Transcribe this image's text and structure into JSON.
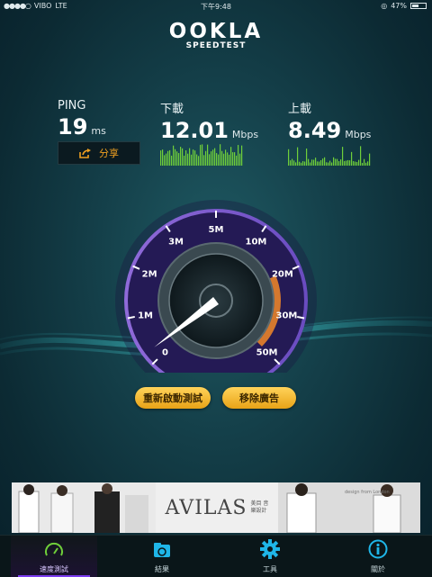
{
  "status_bar": {
    "signal": "●●●●○",
    "carrier": "VIBO",
    "network": "LTE",
    "time": "下午9:48",
    "battery_percent": 47,
    "battery_label": "47%"
  },
  "logo": {
    "main": "OOKLA",
    "sub": "SPEEDTEST"
  },
  "ping": {
    "label": "PING",
    "value": "19",
    "unit": "ms"
  },
  "download": {
    "label": "下載",
    "value": "12.01",
    "unit": "Mbps"
  },
  "upload": {
    "label": "上載",
    "value": "8.49",
    "unit": "Mbps"
  },
  "share_button": {
    "label": "分享",
    "icon": "share-icon"
  },
  "gauge": {
    "ticks": [
      "0",
      "1M",
      "2M",
      "3M",
      "5M",
      "10M",
      "20M",
      "30M",
      "50M"
    ],
    "needle_value": "0",
    "accent_color": "#7b3cf0",
    "highlight_color": "#e8832a"
  },
  "buttons": {
    "restart": "重新啟動測試",
    "remove_ads": "移除廣告"
  },
  "ad": {
    "brand": "AVILAS",
    "brand_sub": "美目 音樂設計",
    "tagline": "design from London"
  },
  "tabs": [
    {
      "label": "速度測試",
      "icon": "speedometer-icon",
      "active": true
    },
    {
      "label": "結果",
      "icon": "results-icon",
      "active": false
    },
    {
      "label": "工具",
      "icon": "gear-icon",
      "active": false
    },
    {
      "label": "關於",
      "icon": "info-icon",
      "active": false
    }
  ],
  "colors": {
    "accent": "#f0a020",
    "graph": "#6fcf3a",
    "background": "#143f49"
  }
}
